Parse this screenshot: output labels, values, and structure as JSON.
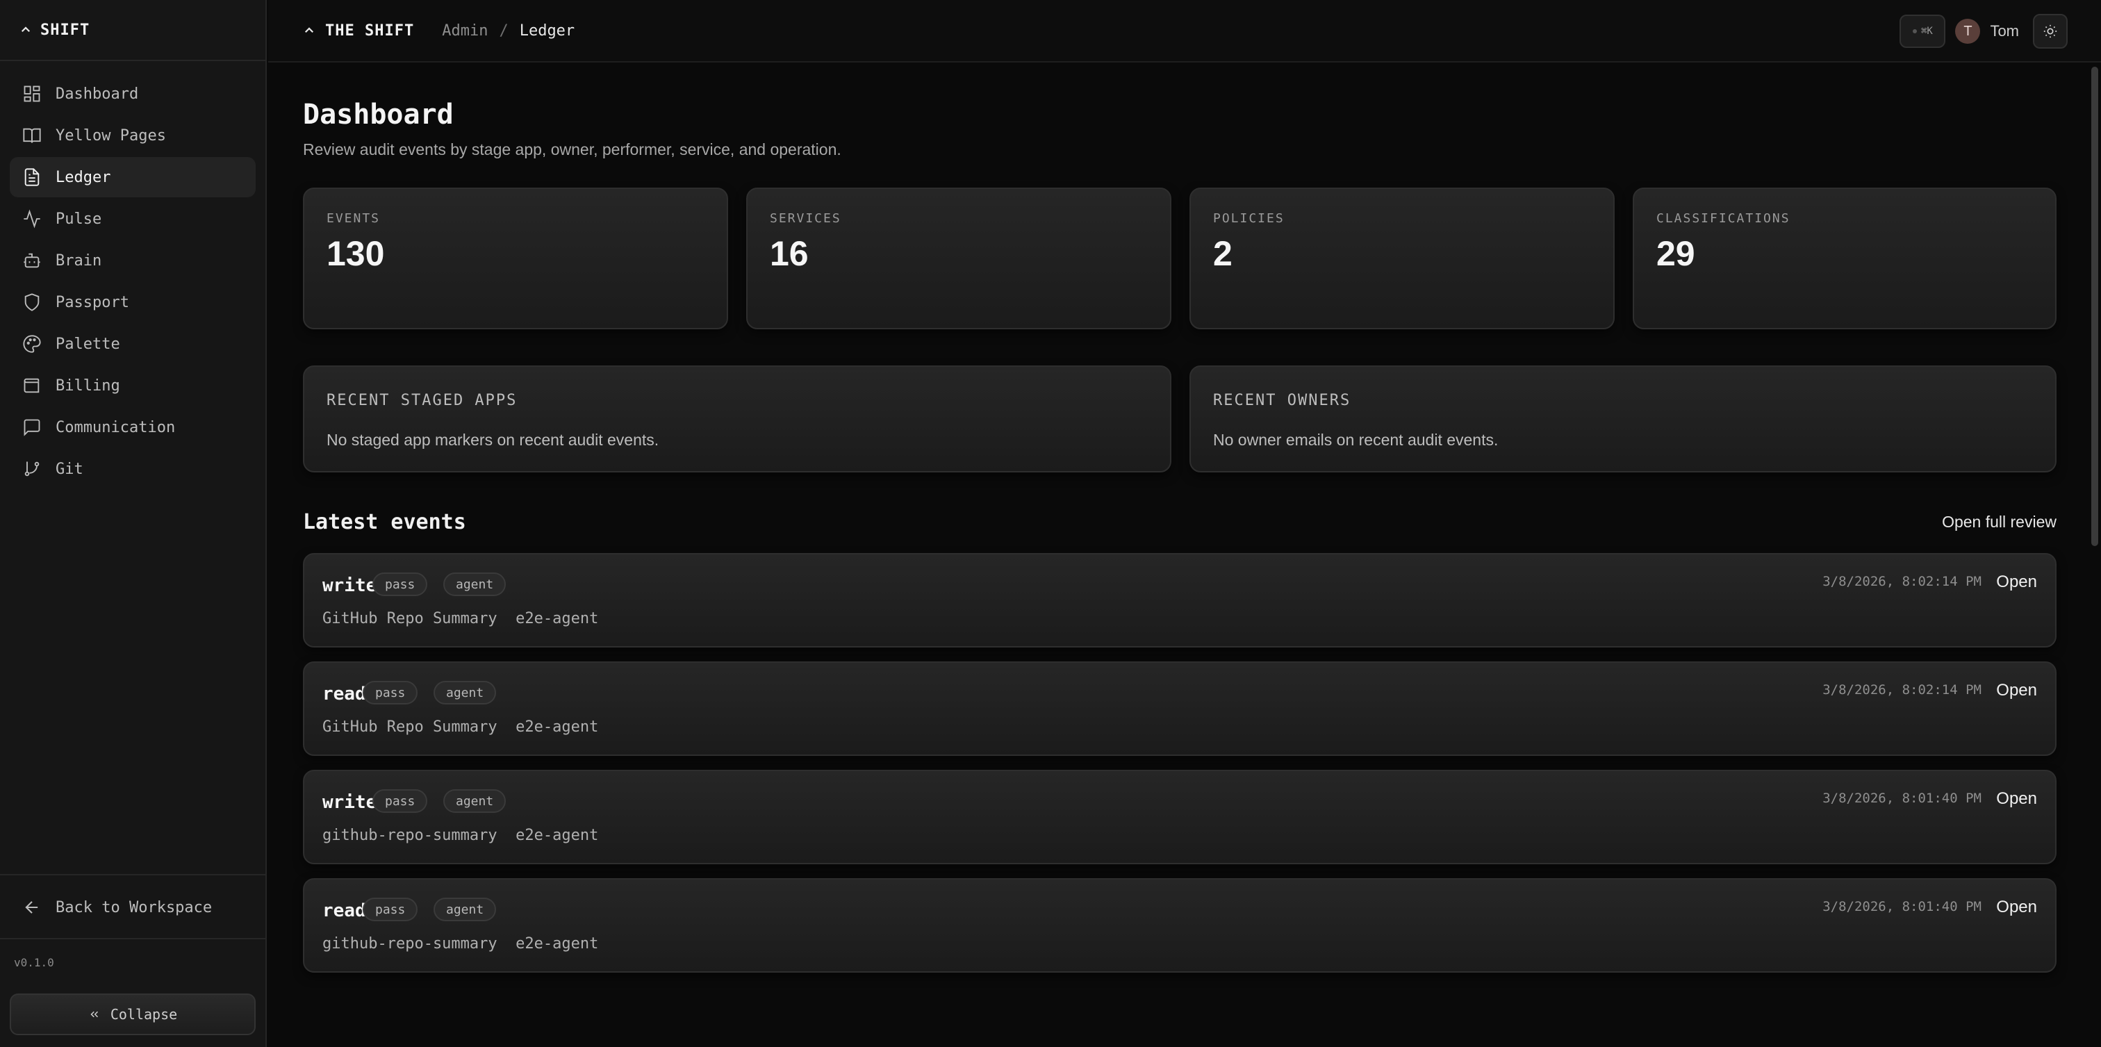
{
  "sidebar": {
    "brand": "SHIFT",
    "items": [
      {
        "label": "Dashboard",
        "icon": "dashboard-icon"
      },
      {
        "label": "Yellow Pages",
        "icon": "book-icon"
      },
      {
        "label": "Ledger",
        "icon": "document-icon",
        "active": true
      },
      {
        "label": "Pulse",
        "icon": "pulse-icon"
      },
      {
        "label": "Brain",
        "icon": "bot-icon"
      },
      {
        "label": "Passport",
        "icon": "shield-icon"
      },
      {
        "label": "Palette",
        "icon": "palette-icon"
      },
      {
        "label": "Billing",
        "icon": "wallet-icon"
      },
      {
        "label": "Communication",
        "icon": "message-icon"
      },
      {
        "label": "Git",
        "icon": "git-branch-icon"
      }
    ],
    "back_label": "Back to Workspace",
    "version": "v0.1.0",
    "collapse_label": "Collapse"
  },
  "topbar": {
    "brand": "THE SHIFT",
    "breadcrumb": {
      "parent": "Admin",
      "separator": "/",
      "current": "Ledger"
    },
    "shortcut": "⌘K",
    "avatar_initial": "T",
    "user": "Tom"
  },
  "page": {
    "title": "Dashboard",
    "subtitle": "Review audit events by stage app, owner, performer, service, and operation."
  },
  "stats": [
    {
      "label": "EVENTS",
      "value": "130"
    },
    {
      "label": "SERVICES",
      "value": "16"
    },
    {
      "label": "POLICIES",
      "value": "2"
    },
    {
      "label": "CLASSIFICATIONS",
      "value": "29"
    }
  ],
  "panels": {
    "staged": {
      "title": "RECENT STAGED APPS",
      "text": "No staged app markers on recent audit events."
    },
    "owners": {
      "title": "RECENT OWNERS",
      "text": "No owner emails on recent audit events."
    }
  },
  "latest": {
    "title": "Latest events",
    "link": "Open full review",
    "events": [
      {
        "op": "write",
        "status": "pass",
        "actor": "agent",
        "meta": "GitHub Repo Summary  e2e-agent",
        "time": "3/8/2026, 8:02:14 PM",
        "open": "Open"
      },
      {
        "op": "read",
        "status": "pass",
        "actor": "agent",
        "meta": "GitHub Repo Summary  e2e-agent",
        "time": "3/8/2026, 8:02:14 PM",
        "open": "Open"
      },
      {
        "op": "write",
        "status": "pass",
        "actor": "agent",
        "meta": "github-repo-summary  e2e-agent",
        "time": "3/8/2026, 8:01:40 PM",
        "open": "Open"
      },
      {
        "op": "read",
        "status": "pass",
        "actor": "agent",
        "meta": "github-repo-summary  e2e-agent",
        "time": "3/8/2026, 8:01:40 PM",
        "open": "Open"
      }
    ]
  }
}
